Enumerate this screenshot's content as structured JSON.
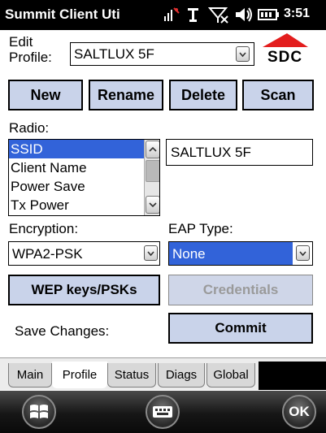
{
  "titlebar": {
    "title": "Summit Client Uti",
    "time": "3:51",
    "icons": [
      "signal-volume-icon",
      "signal-strength-icon",
      "network-off-icon",
      "speaker-icon",
      "battery-icon"
    ]
  },
  "profile": {
    "label_line1": "Edit",
    "label_line2": "Profile:",
    "value": "SALTLUX 5F"
  },
  "logo": {
    "text": "SDC",
    "accent": "#e31d1d"
  },
  "actions": {
    "new": "New",
    "rename": "Rename",
    "delete": "Delete",
    "scan": "Scan"
  },
  "radio": {
    "label": "Radio:",
    "items": [
      "SSID",
      "Client Name",
      "Power Save",
      "Tx Power"
    ],
    "selected_index": 0,
    "value": "SALTLUX 5F"
  },
  "encryption": {
    "label": "Encryption:",
    "value": "WPA2-PSK"
  },
  "eap": {
    "label": "EAP Type:",
    "value": "None"
  },
  "buttons": {
    "wep_keys": "WEP keys/PSKs",
    "credentials": "Credentials",
    "commit": "Commit"
  },
  "save_changes_label": "Save Changes:",
  "tabs": [
    "Main",
    "Profile",
    "Status",
    "Diags",
    "Global"
  ],
  "active_tab": "Profile",
  "bottombar": {
    "start_icon": "windows-start-icon",
    "keyboard_icon": "keyboard-icon",
    "ok_label": "OK"
  },
  "colors": {
    "selection": "#3263d9",
    "button_fill": "#c9d3ea",
    "title_bar": "#000000"
  }
}
